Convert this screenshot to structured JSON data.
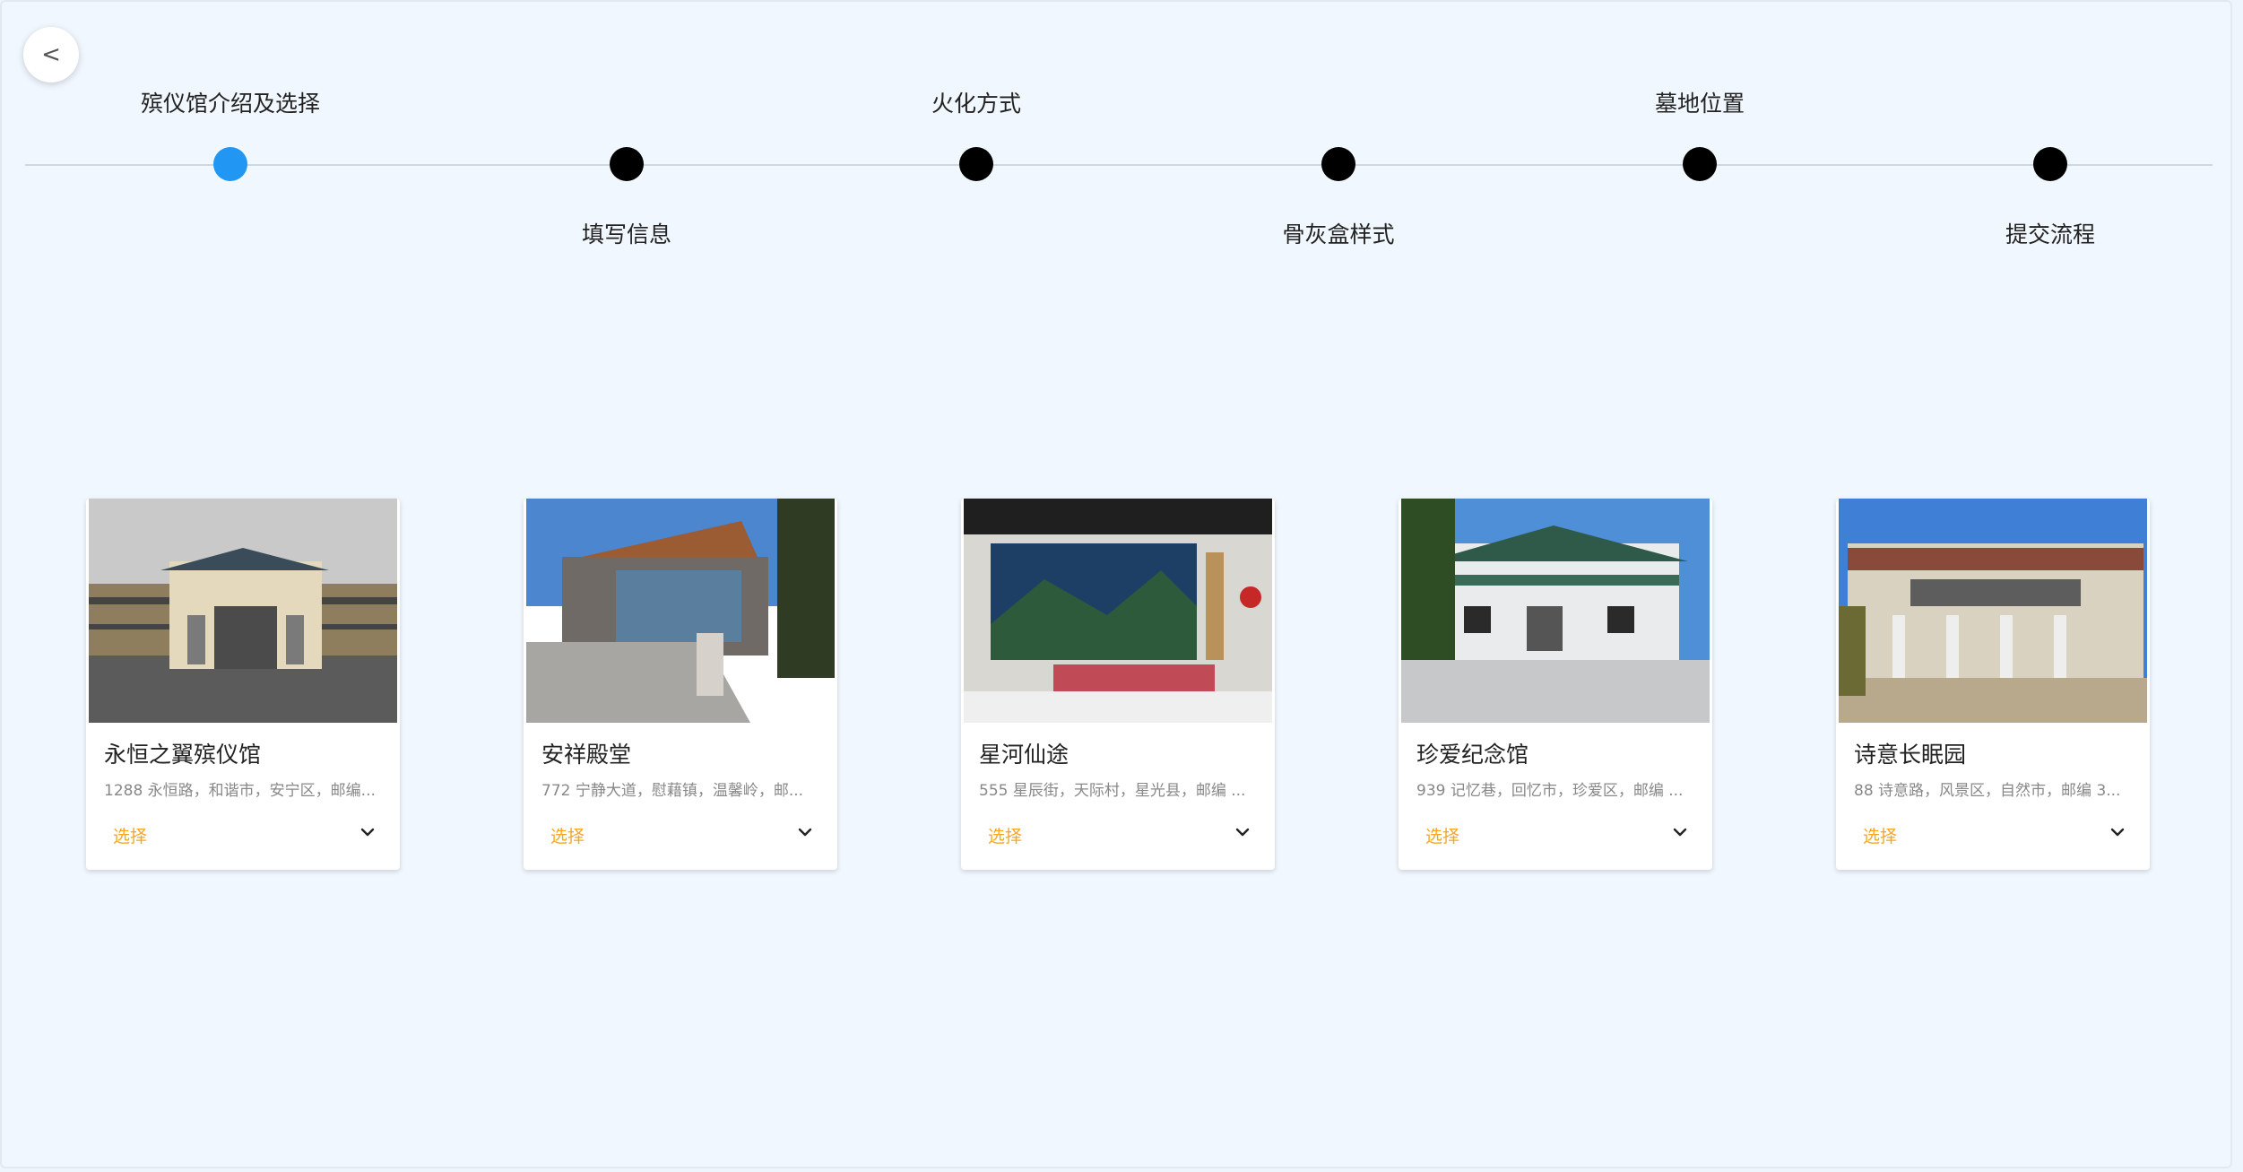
{
  "nav": {
    "back_label": "<"
  },
  "steps": [
    {
      "label": "殡仪馆介绍及选择",
      "state": "active"
    },
    {
      "label": "填写信息",
      "state": "pending"
    },
    {
      "label": "火化方式",
      "state": "pending"
    },
    {
      "label": "骨灰盒样式",
      "state": "pending"
    },
    {
      "label": "墓地位置",
      "state": "pending"
    },
    {
      "label": "提交流程",
      "state": "pending"
    }
  ],
  "colors": {
    "active_step": "#2196f3",
    "pending_step": "#000000",
    "select_text": "#f5a623",
    "page_bg": "#f1f7fe"
  },
  "cards": [
    {
      "name": "永恒之翼殡仪馆",
      "address": "1288 永恒路，和谐市，安宁区，邮编...",
      "select_label": "选择",
      "expand_icon": "chevron-down-icon"
    },
    {
      "name": "安祥殿堂",
      "address": "772 宁静大道，慰藉镇，温馨岭，邮...",
      "select_label": "选择",
      "expand_icon": "chevron-down-icon"
    },
    {
      "name": "星河仙途",
      "address": "555 星辰街，天际村，星光县，邮编 ...",
      "select_label": "选择",
      "expand_icon": "chevron-down-icon"
    },
    {
      "name": "珍爱纪念馆",
      "address": "939 记忆巷，回忆市，珍爱区，邮编 ...",
      "select_label": "选择",
      "expand_icon": "chevron-down-icon"
    },
    {
      "name": "诗意长眠园",
      "address": "88 诗意路，风景区，自然市，邮编 3...",
      "select_label": "选择",
      "expand_icon": "chevron-down-icon"
    }
  ]
}
